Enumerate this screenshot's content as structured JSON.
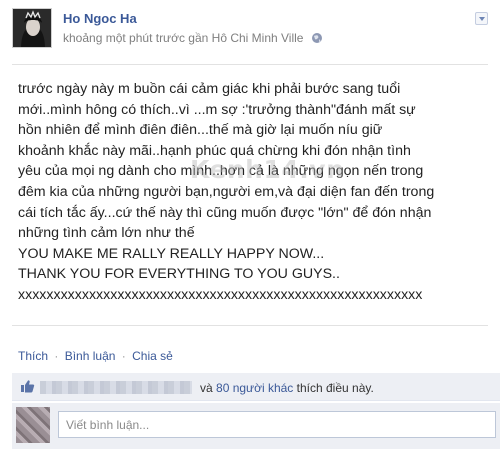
{
  "post": {
    "author": "Ho Ngoc Ha",
    "meta": "khoảng một phút trước gần Hô Chi Minh Ville",
    "lines": [
      "trước ngày này m buồn cái cảm giác khi phải bước sang tuổi",
      "mới..mình hông có thích..vì ...m sợ :'trưởng thành\"đánh mất sự",
      "hồn nhiên để mình điên điên...thế mà giờ lại muốn níu giữ",
      "khoảnh khắc này mãi..hạnh phúc quá chừng khi đón nhận tình",
      "yêu của mọi ng dành cho mình..hơn cả là những ngọn nến trong",
      "đêm kia của những người bạn,người em,và đại diện fan đến trong",
      "cái tích tắc ấy...cứ thế này thì cũng muốn được \"lớn\" để đón nhận",
      "những tình cảm lớn như thế",
      "YOU MAKE ME RALLY REALLY HAPPY NOW...",
      "THANK YOU FOR EVERYTHING TO YOU GUYS..",
      "xxxxxxxxxxxxxxxxxxxxxxxxxxxxxxxxxxxxxxxxxxxxxxxxxxxxxxxxx"
    ],
    "watermark": "Kenh14.vn"
  },
  "actions": {
    "like": "Thích",
    "comment": "Bình luận",
    "share": "Chia sẻ",
    "separator": "·"
  },
  "likes": {
    "and": "và",
    "others": "80 người khác",
    "suffix": "thích điều này."
  },
  "comment_box": {
    "placeholder": "Viết bình luận..."
  },
  "icons": {
    "chevron": "chevron-down-icon",
    "globe": "globe-icon",
    "like": "thumbs-up-icon"
  },
  "colors": {
    "link": "#3b5998",
    "feedback_bg": "#edeff4"
  }
}
